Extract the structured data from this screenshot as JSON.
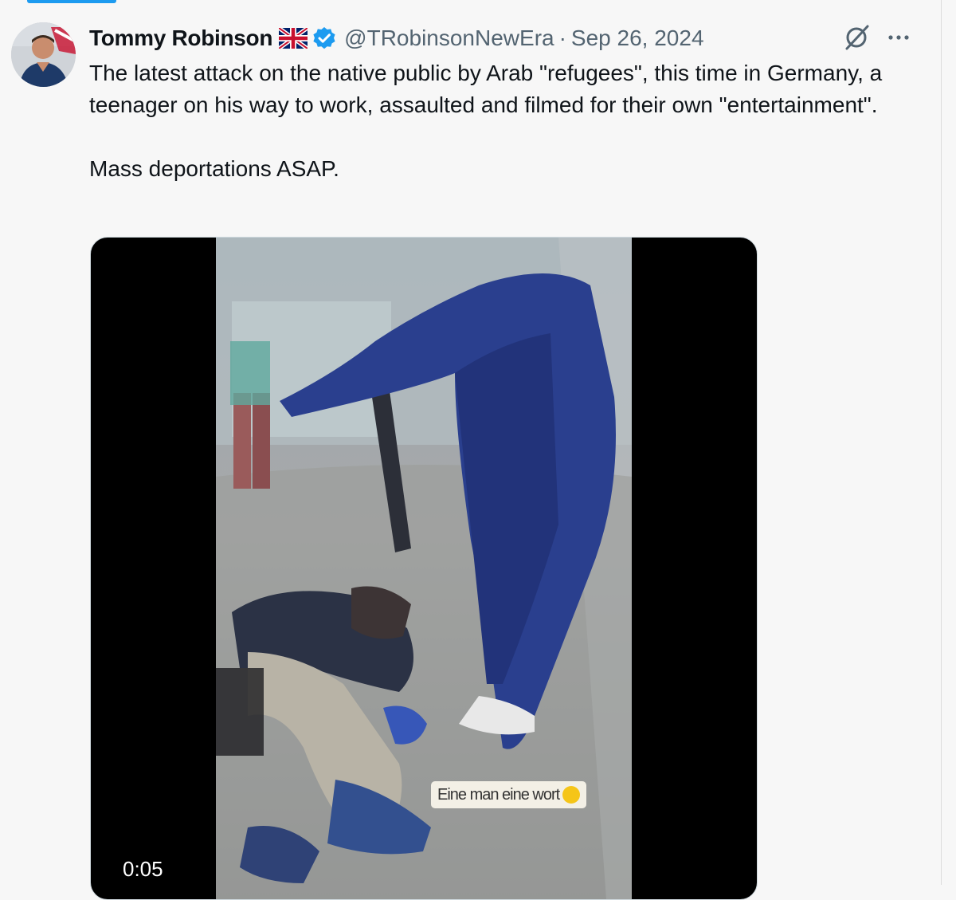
{
  "tweet": {
    "author": {
      "name": "Tommy Robinson",
      "flag_icon": "uk-flag-icon",
      "verified_icon": "verified-badge-icon",
      "handle": "@TRobinsonNewEra",
      "separator": "·",
      "date": "Sep 26, 2024"
    },
    "text": {
      "line1": "The latest attack on the native public by Arab \"refugees\", this time in Germany, a teenager on his way to work, assaulted and filmed for their own \"entertainment\".",
      "line2": "Mass deportations ASAP."
    },
    "video": {
      "sticker_text": "Eine man eine wort",
      "duration": "0:05"
    }
  },
  "colors": {
    "accent": "#1d9bf0",
    "text_primary": "#0f1419",
    "text_secondary": "#536471",
    "background": "#f7f7f7"
  },
  "actions": {
    "grok_icon": "grok-icon",
    "more_icon": "more-icon"
  }
}
